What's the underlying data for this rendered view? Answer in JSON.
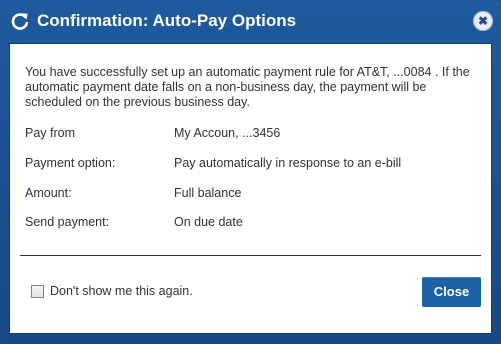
{
  "dialog": {
    "title": "Confirmation: Auto-Pay Options",
    "close_icon_glyph": "✖",
    "message": "You have successfully set up an automatic payment rule for AT&T, ...0084 . If the automatic payment date falls on a non-business day, the payment will be scheduled on the previous business day.",
    "details": [
      {
        "label": "Pay from",
        "value": "My Accoun, ...3456"
      },
      {
        "label": "Payment option:",
        "value": "Pay automatically in response to an e-bill"
      },
      {
        "label": "Amount:",
        "value": "Full balance"
      },
      {
        "label": "Send payment:",
        "value": "On due date"
      }
    ],
    "dont_show_label": "Don't show me this again.",
    "dont_show_checked": false,
    "close_button_label": "Close"
  },
  "colors": {
    "titlebar": "#1f5a9e",
    "button": "#1d62a7",
    "text": "#333333"
  },
  "icons": [
    "refresh-icon",
    "close-icon",
    "checkbox"
  ]
}
